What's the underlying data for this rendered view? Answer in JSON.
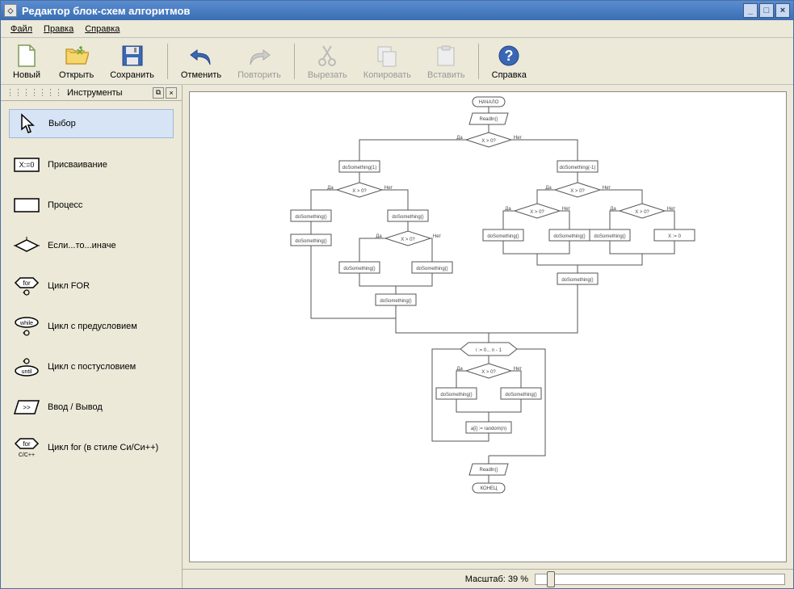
{
  "window": {
    "title": "Редактор блок-схем алгоритмов"
  },
  "menu": {
    "file": "Файл",
    "edit": "Правка",
    "help": "Справка"
  },
  "toolbar": {
    "new": "Новый",
    "open": "Открыть",
    "save": "Сохранить",
    "undo": "Отменить",
    "redo": "Повторить",
    "cut": "Вырезать",
    "copy": "Копировать",
    "paste": "Вставить",
    "help": "Справка"
  },
  "panel": {
    "title": "Инструменты"
  },
  "tools": {
    "select": "Выбор",
    "assign": "Присваивание",
    "process": "Процесс",
    "ifelse": "Если...то...иначе",
    "for": "Цикл FOR",
    "while": "Цикл с предусловием",
    "until": "Цикл с постусловием",
    "io": "Ввод / Вывод",
    "cfor": "Цикл for (в стиле Си/Си++)"
  },
  "status": {
    "zoom_label": "Масштаб: 39 %"
  },
  "flowchart": {
    "start": "НАЧАЛО",
    "end": "КОНЕЦ",
    "readln": "Readln()",
    "cond": "X > 0?",
    "yes": "Да",
    "no": "Нет",
    "ds": "doSomething()",
    "ds1": "doSomething(1)",
    "dsm1": "doSomething(-1)",
    "forloop": "i := 0... n - 1",
    "xzero": "X := 0",
    "rand": "a[i] := random(n)"
  }
}
